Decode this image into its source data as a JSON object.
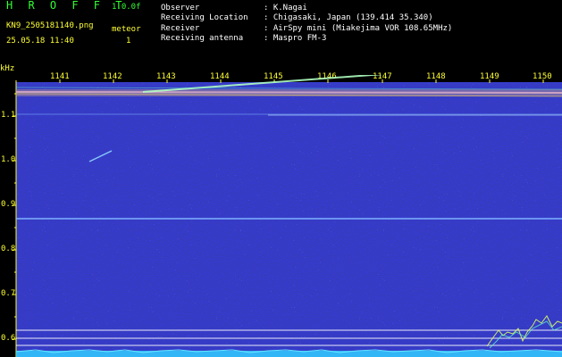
{
  "app": {
    "title": "H R O F F T",
    "version": "1.0.0f",
    "filename": "KN9_2505181140.png",
    "timestamp": "25.05.18 11:40",
    "mode_label": "meteor",
    "mode_value": "1"
  },
  "info": {
    "rows": [
      {
        "label": "Observer",
        "value": ": K.Nagai"
      },
      {
        "label": "Receiving Location",
        "value": ": Chigasaki, Japan (139.414 35.340)"
      },
      {
        "label": "Receiver",
        "value": ": AirSpy mini (Miakejima VOR 108.65MHz)"
      },
      {
        "label": "Receiving antenna",
        "value": ": Maspro FM-3"
      }
    ]
  },
  "axis": {
    "unit": "kHz",
    "time_ticks": [
      "1141",
      "1142",
      "1143",
      "1144",
      "1145",
      "1146",
      "1147",
      "1148",
      "1149",
      "1150"
    ],
    "freq_ticks": [
      "1.1",
      "1.0",
      "0.9",
      "0.8",
      "0.7",
      "0.6"
    ]
  },
  "colors": {
    "text_yellow": "#ffff33",
    "text_white": "#ffffff",
    "background_noise": "#0a0a5a",
    "line_blue": "#7fb4ff",
    "baseline_cyan": "#33ccff"
  }
}
